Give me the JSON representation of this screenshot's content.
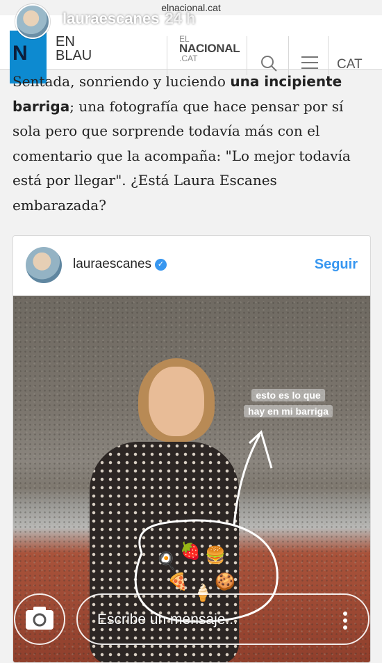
{
  "story": {
    "username": "lauraescanes",
    "time_ago": "24 h",
    "domain": "elnacional.cat"
  },
  "site": {
    "logo_letter": "N",
    "section_line1": "EN",
    "section_line2": "BLAU",
    "brand_top": "EL",
    "brand_main": "NACIONAL",
    "brand_bottom": ".CAT",
    "language": "CAT",
    "icons": [
      "search-icon",
      "menu-icon"
    ]
  },
  "article": {
    "p1": "Sentada, sonriendo y luciendo ",
    "bold": "una incipiente barriga",
    "p2": "; una fotografía que hace pensar por sí sola pero que sorprende todavía más con el comentario que la acompaña: \"Lo mejor todavía está por llegar\". ¿Está Laura Escanes embarazada?"
  },
  "embed": {
    "username": "lauraescanes",
    "follow_label": "Seguir",
    "sticker_line1": "esto es lo que",
    "sticker_line2": "hay en mi barriga",
    "food_emojis": [
      "🍳",
      "🍓",
      "🍔",
      "🍕",
      "🍦",
      "🍪"
    ]
  },
  "reply": {
    "placeholder": "Escribe un mensaje..."
  }
}
